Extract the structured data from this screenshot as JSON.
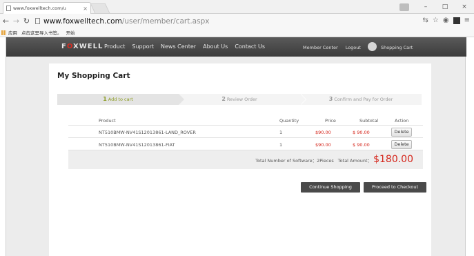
{
  "browser": {
    "tab_title": "www.foxwelltech.com/u",
    "tab_close": "×",
    "url_host": "www.foxwelltech.com",
    "url_path": "/user/member/cart.aspx",
    "bookmarks": [
      "应用",
      "点击这里导入书签。",
      "开始"
    ],
    "window_controls": [
      "–",
      "□",
      "×"
    ]
  },
  "site": {
    "logo_prefix": "F",
    "logo_x": "O",
    "logo_rest": "XWELL",
    "menu": [
      "Product",
      "Support",
      "News Center",
      "About Us",
      "Contact Us"
    ],
    "member_center": "Member Center",
    "logout": "Logout",
    "shopping_cart": "Shopping Cart"
  },
  "cart": {
    "title": "My Shopping Cart",
    "steps": [
      {
        "num": "1",
        "label": "Add to cart"
      },
      {
        "num": "2",
        "label": "Review Order"
      },
      {
        "num": "3",
        "label": "Confirm and Pay for Order"
      }
    ],
    "headers": {
      "product": "Product",
      "quantity": "Quantity",
      "price": "Price",
      "subtotal": "Subtotal",
      "action": "Action"
    },
    "items": [
      {
        "product": "NT510BMW-NV41S12013861-LAND_ROVER",
        "quantity": "1",
        "price": "$90.00",
        "subtotal": "$ 90.00",
        "action": "Delete"
      },
      {
        "product": "NT510BMW-NV41S12013861-FIAT",
        "quantity": "1",
        "price": "$90.00",
        "subtotal": "$ 90.00",
        "action": "Delete"
      }
    ],
    "total_software": "Total Number of Software：2Pieces",
    "total_amount_label": "Total Amount：",
    "total_amount": "$180.00",
    "continue_label": "Continue Shopping",
    "checkout_label": "Proceed to Checkout"
  },
  "colors": {
    "price_red": "#d5251b",
    "step_active": "#8a9a1f",
    "nav_bg": "#444444"
  }
}
